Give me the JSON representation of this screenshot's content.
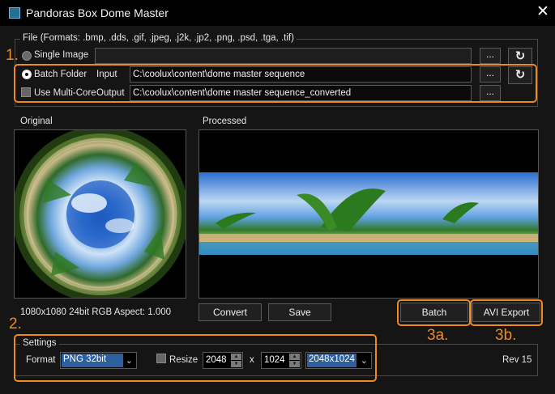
{
  "window": {
    "title": "Pandoras Box Dome Master",
    "close_glyph": "✕"
  },
  "file_group": {
    "legend": "File (Formats: .bmp, .dds, .gif, .jpeg, .j2k, .jp2, .png, .psd, .tga, .tif)",
    "single_image_label": "Single Image",
    "single_image_value": "",
    "batch_folder_label": "Batch Folder",
    "multicore_label": "Use Multi-Core",
    "input_label": "Input",
    "input_value": "C:\\coolux\\content\\dome master sequence",
    "output_label": "Output",
    "output_value": "C:\\coolux\\content\\dome master sequence_converted",
    "browse_label": "...",
    "refresh_glyph": "↻",
    "selected_mode": "Batch Folder"
  },
  "preview": {
    "original_label": "Original",
    "processed_label": "Processed",
    "image_info": "1080x1080 24bit RGB Aspect: 1.000"
  },
  "actions": {
    "convert_label": "Convert",
    "save_label": "Save",
    "batch_label": "Batch",
    "avi_export_label": "AVI Export"
  },
  "settings": {
    "legend": "Settings",
    "format_label": "Format",
    "format_value": "PNG 32bit",
    "resize_label": "Resize",
    "width_value": "2048",
    "x_label": "x",
    "height_value": "1024",
    "preset_value": "2048x1024",
    "rev_label": "Rev 15"
  },
  "annotations": {
    "step1": "1.",
    "step2": "2.",
    "step3a": "3a.",
    "step3b": "3b.",
    "color": "#f08a1c"
  }
}
